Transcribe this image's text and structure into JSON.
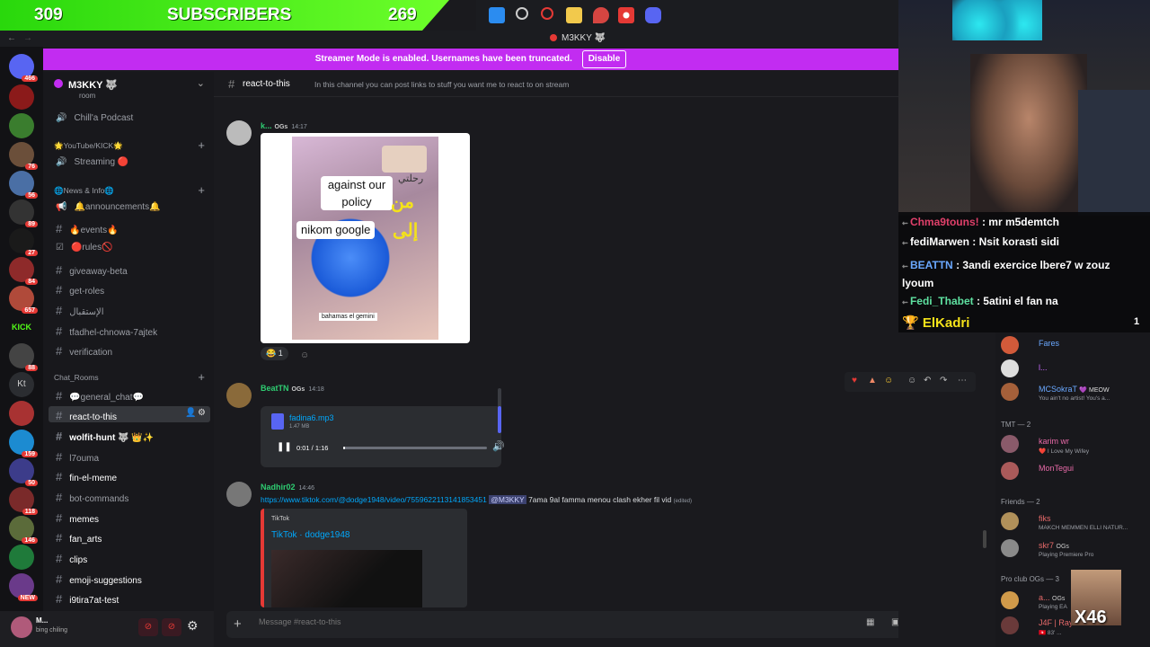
{
  "overlay": {
    "subs_left": "309",
    "subs_label": "SUBSCRIBERS",
    "subs_right": "269"
  },
  "window_title": "M3KKY 🐺",
  "streamer_mode": {
    "text": "Streamer Mode is enabled. Usernames have been truncated.",
    "button": "Disable"
  },
  "rail_badges": [
    "466",
    "76",
    "56",
    "89",
    "27",
    "84",
    "657",
    "88",
    "Kt",
    "159",
    "50",
    "118",
    "146",
    "NEW"
  ],
  "server": {
    "name": "M3KKY 🐺"
  },
  "sidebar": {
    "partial_top": "room",
    "chill_podcast": "Chill'a Podcast",
    "cat_youtube": "🌟YouTube/KICK🌟",
    "streaming": "Streaming 🔴",
    "cat_news": "🌐News & Info🌐",
    "announcements": "🔔announcements🔔",
    "events": "🔥events🔥",
    "rules": "🔴rules🚫",
    "giveaway": "giveaway-beta",
    "getroles": "get-roles",
    "istiqbal": "الإستقبال",
    "tfadhel": "tfadhel-chnowa-7ajtek",
    "verification": "verification",
    "cat_chat": "Chat_Rooms",
    "general_chat": "💬general_chat💬",
    "react": "react-to-this",
    "wolfit": "wolfit-hunt 🐺 👑✨",
    "l7ouma": "l7ouma",
    "finel": "fin-el-meme",
    "botcommands": "bot-commands",
    "memes": "memes",
    "fanarts": "fan_arts",
    "clips": "clips",
    "emoji": "emoji-suggestions",
    "i9tira7at": "i9tira7at-test"
  },
  "user_panel": {
    "name": "M...",
    "status": "bing chiling"
  },
  "channel": {
    "name": "react-to-this",
    "topic": "In this channel you can post links to stuff you want me to react to on stream"
  },
  "messages": {
    "m1_name": "k...",
    "m1_role": "OGs",
    "m1_time": "14:17",
    "img_text1": "against our policy",
    "img_text2": "nikom google",
    "img_arabic1": "من",
    "img_arabic2": "إلى",
    "img_arabic3": "رحلتي",
    "img_caption": "bahamas el gemini",
    "reaction_count": "1",
    "m2_name": "BeatTN",
    "m2_role": "OGs",
    "m2_time": "14:18",
    "audio_file": "fadina6.mp3",
    "audio_size": "1.47 MB",
    "audio_time": "0:01 / 1:16",
    "audio_progress": 0.01,
    "m3_name": "Nadhir02",
    "m3_time": "14:46",
    "m3_link": "https://www.tiktok.com/@dodge1948/video/7559622113141853451",
    "m3_mention": "@M3KKY",
    "m3_text": "7ama 9al famma menou clash ekher fil vid",
    "m3_edited": "(edited)",
    "embed_provider": "TikTok",
    "embed_title": "TikTok · dodge1948"
  },
  "composer": {
    "placeholder": "Message #react-to-this"
  },
  "stream_chat": [
    {
      "user": "Chma9touns!",
      "text": ": mr m5demtch",
      "color": "#e0406a"
    },
    {
      "user": "fediMarwen",
      "text": ": Nsit korasti sidi",
      "color": "#ffffff"
    },
    {
      "user": "BEATTN",
      "text": ": 3andi exercice lbere7 w zouz lyoum",
      "color": "#6aa8ff"
    },
    {
      "user": "Fedi_Thabet",
      "text": ": 5atini el fan na",
      "color": "#5ee0a0"
    }
  ],
  "top_chatter": {
    "name": "ElKadri",
    "count": "1"
  },
  "members": {
    "fares": "Fares",
    "l": "l...",
    "mcsokrat": "MCSokraT",
    "mcsokrat_tag": "💜 MEOW",
    "mcsokrat_sub": "You ain't no artist! You's a...",
    "grp_tmt": "TMT — 2",
    "karim": "karim wr",
    "karim_sub": "❤️ I Love My Wifey",
    "montegui": "MonTegui",
    "grp_friends": "Friends — 2",
    "f1": "fiks",
    "f1_sub": "MAKCH MEMMEN ELLI NATUR...",
    "f2": "skr7",
    "f2_role": "OGs",
    "f2_sub": "Playing Premiere Pro",
    "grp_pro": "Pro club OGs — 3",
    "p1": "a...",
    "p1_role": "OGs",
    "p1_sub": "Playing EA",
    "p2": "J4F | Rayen",
    "p2_sub": "🇹🇳 83' ...",
    "x46": "X46"
  }
}
